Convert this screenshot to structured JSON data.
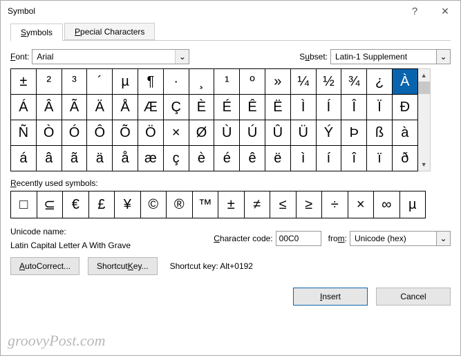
{
  "window": {
    "title": "Symbol"
  },
  "tabs": {
    "symbols": "Symbols",
    "special": "Special Characters"
  },
  "font": {
    "label": "Font:",
    "value": "Arial"
  },
  "subset": {
    "label": "Subset:",
    "value": "Latin-1 Supplement"
  },
  "grid": [
    [
      "±",
      "²",
      "³",
      "´",
      "µ",
      "¶",
      "·",
      "¸",
      "¹",
      "º",
      "»",
      "¼",
      "½",
      "¾",
      "¿",
      "À"
    ],
    [
      "Á",
      "Â",
      "Ã",
      "Ä",
      "Å",
      "Æ",
      "Ç",
      "È",
      "É",
      "Ê",
      "Ë",
      "Ì",
      "Í",
      "Î",
      "Ï",
      "Ð"
    ],
    [
      "Ñ",
      "Ò",
      "Ó",
      "Ô",
      "Õ",
      "Ö",
      "×",
      "Ø",
      "Ù",
      "Ú",
      "Û",
      "Ü",
      "Ý",
      "Þ",
      "ß",
      "à"
    ],
    [
      "á",
      "â",
      "ã",
      "ä",
      "å",
      "æ",
      "ç",
      "è",
      "é",
      "ê",
      "ë",
      "ì",
      "í",
      "î",
      "ï",
      "ð"
    ]
  ],
  "selected": {
    "row": 0,
    "col": 15
  },
  "recent_label": "Recently used symbols:",
  "recent": [
    "□",
    "⊆",
    "€",
    "£",
    "¥",
    "©",
    "®",
    "™",
    "±",
    "≠",
    "≤",
    "≥",
    "÷",
    "×",
    "∞",
    "µ"
  ],
  "unicode": {
    "label": "Unicode name:",
    "name": "Latin Capital Letter A With Grave"
  },
  "charcode": {
    "label": "Character code:",
    "value": "00C0"
  },
  "from": {
    "label": "from:",
    "value": "Unicode (hex)"
  },
  "buttons": {
    "autocorrect": "AutoCorrect...",
    "shortcut": "Shortcut Key...",
    "shortcut_label": "Shortcut key: Alt+0192",
    "insert": "Insert",
    "cancel": "Cancel"
  },
  "watermark": "groovyPost.com"
}
